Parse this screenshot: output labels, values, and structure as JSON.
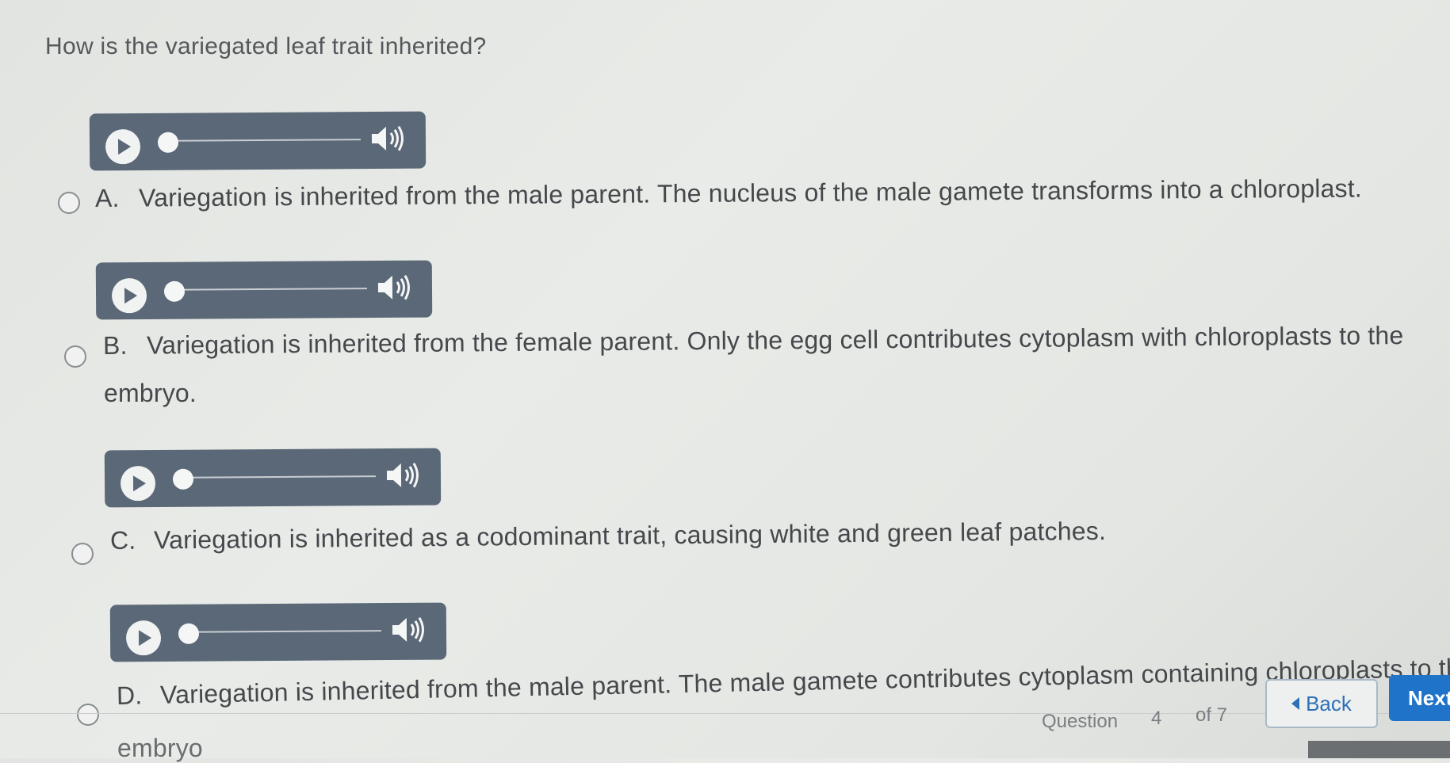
{
  "question": {
    "text": "How is the variegated leaf trait inherited?"
  },
  "options": [
    {
      "letter": "A.",
      "text": "Variegation is inherited from the male parent. The nucleus of the male gamete transforms into a chloroplast."
    },
    {
      "letter": "B.",
      "text": "Variegation is inherited from the female parent. Only the egg cell contributes cytoplasm with chloroplasts to the",
      "continuation": "embryo."
    },
    {
      "letter": "C.",
      "text": "Variegation is inherited as a codominant trait, causing white and green leaf patches."
    },
    {
      "letter": "D.",
      "text": "Variegation is inherited from the male parent. The male gamete contributes cytoplasm containing chloroplasts to the",
      "continuation": "embryo"
    }
  ],
  "footer": {
    "question_label": "Question",
    "question_number": "4",
    "question_total": "of 7",
    "back_label": "Back",
    "next_label": "Next"
  },
  "icons": {
    "play": "play-icon",
    "volume": "volume-icon",
    "back": "caret-left-icon"
  },
  "colors": {
    "player_bg": "#5b6877",
    "accent": "#1f73c9",
    "link": "#2f6fb6"
  }
}
